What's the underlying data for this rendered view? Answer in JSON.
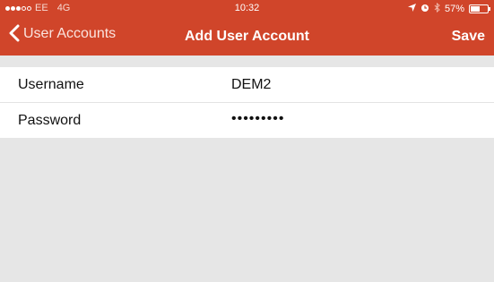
{
  "status_bar": {
    "carrier": "EE",
    "network": "4G",
    "time": "10:32",
    "battery_text": "57%",
    "battery_level": 0.57,
    "signal_filled": 3,
    "signal_total": 5
  },
  "nav": {
    "back_label": "User Accounts",
    "title": "Add User Account",
    "save_label": "Save"
  },
  "form": {
    "rows": [
      {
        "label": "Username",
        "value": "DEM2"
      },
      {
        "label": "Password",
        "value": "•••••••••"
      }
    ]
  },
  "colors": {
    "accent": "#d0452a",
    "background": "#e6e6e6"
  }
}
